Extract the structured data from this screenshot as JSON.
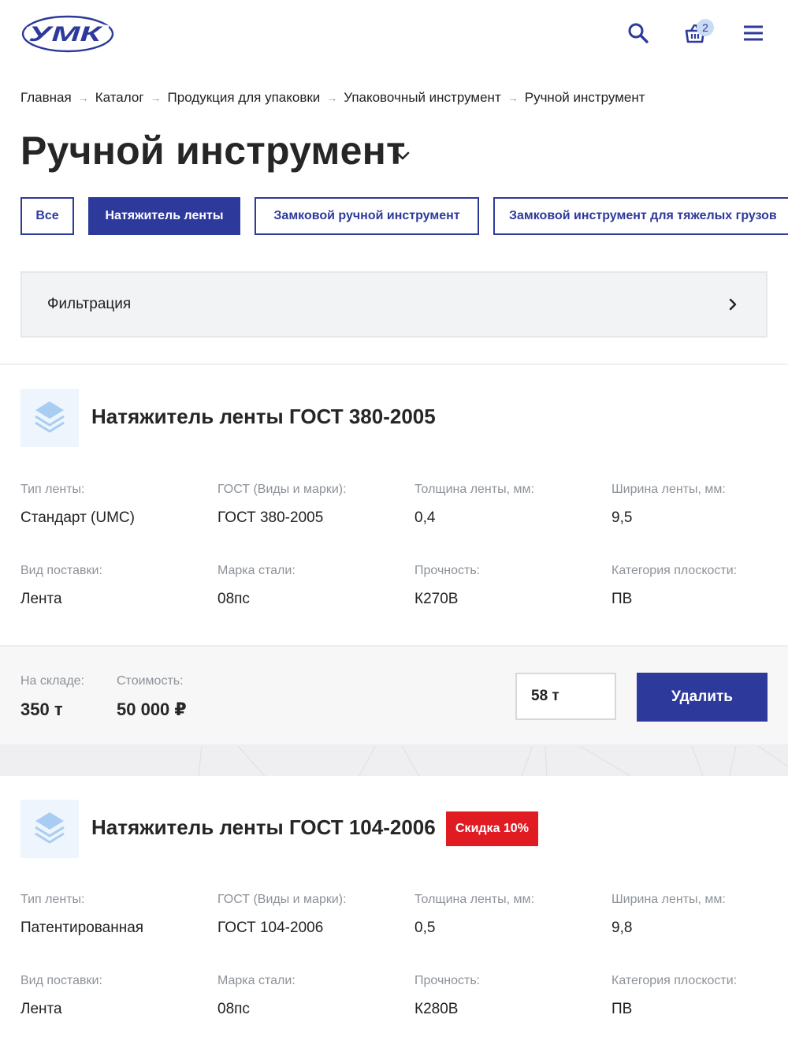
{
  "header": {
    "logo_text": "УМК",
    "cart_count": "2",
    "icons": [
      "search-icon",
      "cart-icon",
      "menu-icon"
    ]
  },
  "breadcrumb": [
    "Главная",
    "Каталог",
    "Продукция для упаковки",
    "Упаковочный инструмент",
    "Ручной инструмент"
  ],
  "breadcrumb_separator": "→",
  "page_title": "Ручной инструмент",
  "tabs": [
    {
      "label": "Все",
      "active": false
    },
    {
      "label": "Натяжитель ленты",
      "active": true
    },
    {
      "label": "Замковой ручной инструмент",
      "active": false
    },
    {
      "label": "Замковой инструмент для тяжелых грузов",
      "active": false
    }
  ],
  "filter": {
    "label": "Фильтрация"
  },
  "products": [
    {
      "title": "Натяжитель ленты ГОСТ 380-2005",
      "discount": "",
      "specs": [
        {
          "label": "Тип ленты:",
          "value": "Стандарт (UMC)"
        },
        {
          "label": "ГОСТ (Виды и марки):",
          "value": "ГОСТ 380-2005"
        },
        {
          "label": "Толщина ленты, мм:",
          "value": "0,4"
        },
        {
          "label": "Ширина ленты, мм:",
          "value": "9,5"
        },
        {
          "label": "Вид поставки:",
          "value": "Лента"
        },
        {
          "label": "Марка стали:",
          "value": "08пс"
        },
        {
          "label": "Прочность:",
          "value": "К270В"
        },
        {
          "label": "Категория плоскости:",
          "value": "ПВ"
        }
      ],
      "stock_label": "На складе:",
      "stock_value": "350 т",
      "price_label": "Стоимость:",
      "price_value": "50 000 ₽",
      "quantity": "58 т",
      "remove_label": "Удалить"
    },
    {
      "title": "Натяжитель ленты ГОСТ 104-2006",
      "discount": "Скидка 10%",
      "specs": [
        {
          "label": "Тип ленты:",
          "value": "Патентированная"
        },
        {
          "label": "ГОСТ (Виды и марки):",
          "value": "ГОСТ 104-2006"
        },
        {
          "label": "Толщина ленты, мм:",
          "value": "0,5"
        },
        {
          "label": "Ширина ленты, мм:",
          "value": "9,8"
        },
        {
          "label": "Вид поставки:",
          "value": "Лента"
        },
        {
          "label": "Марка стали:",
          "value": "08пс"
        },
        {
          "label": "Прочность:",
          "value": "К280В"
        },
        {
          "label": "Категория плоскости:",
          "value": "ПВ"
        }
      ]
    }
  ],
  "colors": {
    "brand": "#2d3a9b",
    "discount": "#e01b22",
    "icon_bg": "#eef5fd",
    "icon_fill": "#a9cdf2"
  }
}
